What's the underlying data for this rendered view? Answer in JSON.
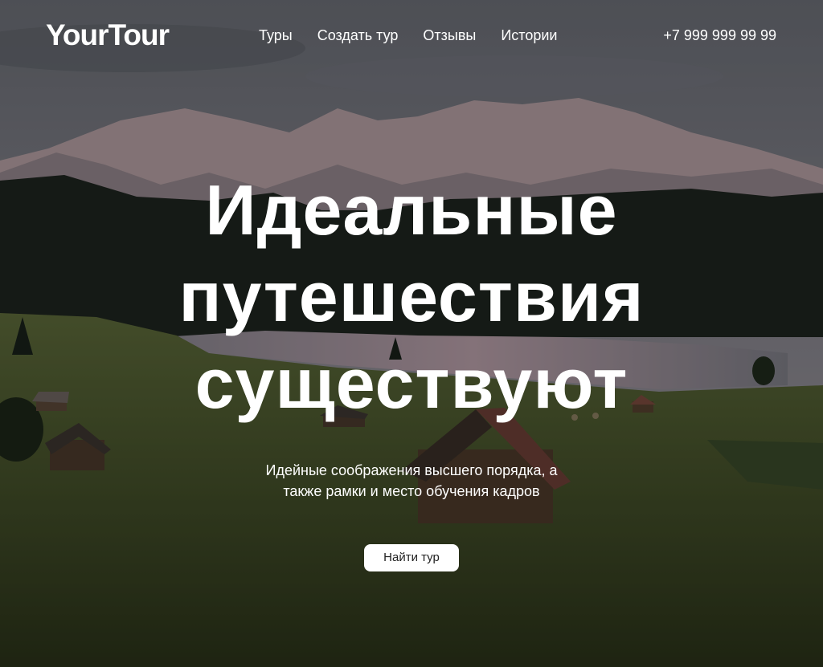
{
  "header": {
    "logo": "YourTour",
    "nav": [
      "Туры",
      "Создать тур",
      "Отзывы",
      "Истории"
    ],
    "phone": "+7 999 999 99 99"
  },
  "hero": {
    "headline_lines": [
      "Идеальные",
      "путешествия",
      "существуют"
    ],
    "subtitle_lines": [
      "Идейные соображения высшего порядка, а",
      "также рамки и место обучения кадров"
    ],
    "button_label": "Найти тур",
    "background": "mountain-lake-meadow-photo"
  },
  "colors": {
    "text": "#ffffff",
    "button_bg": "#ffffff",
    "button_text": "#222222"
  }
}
